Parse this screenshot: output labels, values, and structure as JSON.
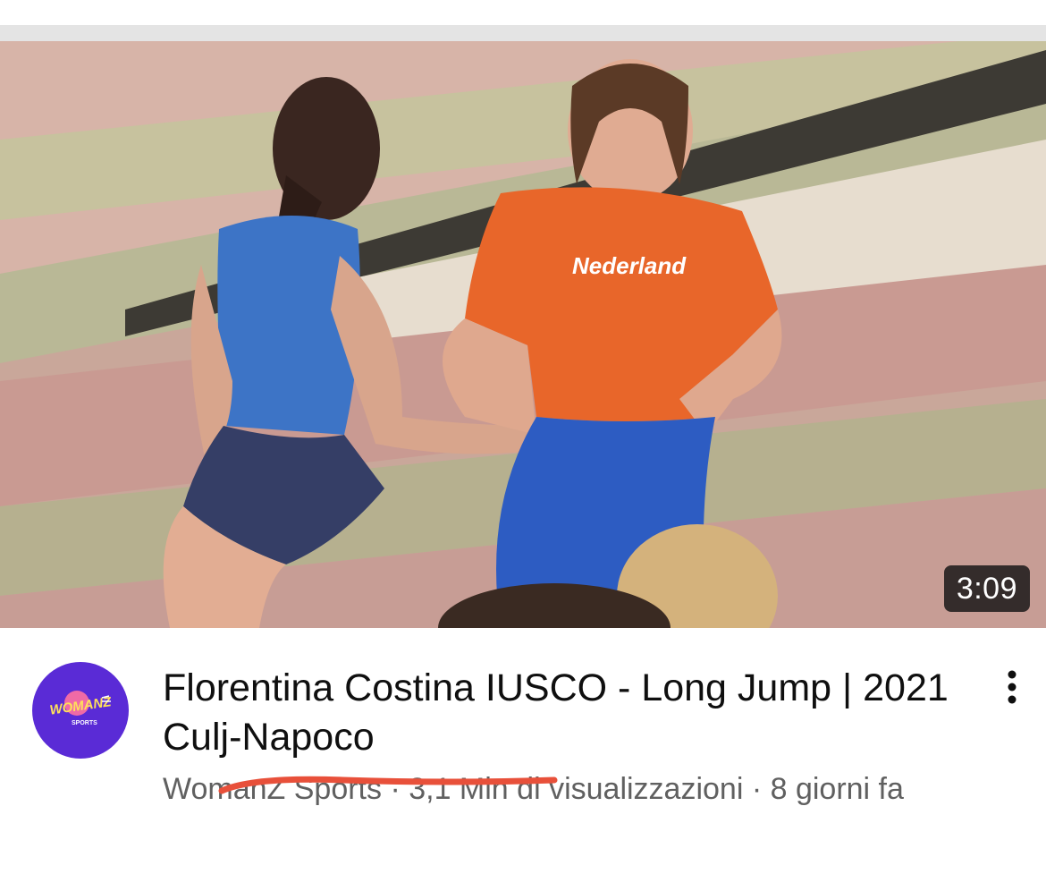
{
  "video": {
    "duration": "3:09",
    "title": "Florentina Costina IUSCO - Long Jump | 2021 Culj-Napoco",
    "meta": "WomanZ Sports · 3,1 Mln di visualizzazioni · 8 giorni fa",
    "shirt_text": "Nederland"
  },
  "channel": {
    "avatar_text": "WOMANZ",
    "avatar_subtext": "SPORTS"
  },
  "menu": {
    "icon": "more-vert-icon"
  },
  "colors": {
    "avatar_bg": "#5a2bd6",
    "annotation_red": "#e8503a",
    "title": "#0f0f0f",
    "meta": "#606060"
  }
}
